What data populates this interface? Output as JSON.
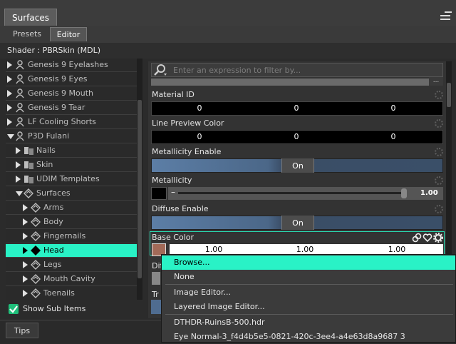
{
  "window": {
    "tab": "Surfaces",
    "menu_icon": "panel-menu-icon"
  },
  "subtabs": {
    "presets": "Presets",
    "editor": "Editor"
  },
  "shader": "Shader :  PBRSkin (MDL)",
  "tree": [
    {
      "label": "Genesis 9 Eyelashes",
      "arrow": "right",
      "icon": "figure-icon",
      "level": 0
    },
    {
      "label": "Genesis 9 Eyes",
      "arrow": "right",
      "icon": "figure-icon",
      "level": 0
    },
    {
      "label": "Genesis 9 Mouth",
      "arrow": "right",
      "icon": "figure-icon",
      "level": 0
    },
    {
      "label": "Genesis 9 Tear",
      "arrow": "right",
      "icon": "figure-icon",
      "level": 0
    },
    {
      "label": "LF Cooling Shorts",
      "arrow": "right",
      "icon": "figure-icon",
      "level": 0
    },
    {
      "label": "P3D Fulani",
      "arrow": "down",
      "icon": "figure-icon",
      "level": 0
    },
    {
      "label": "Nails",
      "arrow": "right",
      "icon": "group-icon",
      "level": 1
    },
    {
      "label": "Skin",
      "arrow": "right",
      "icon": "group-icon",
      "level": 1
    },
    {
      "label": "UDIM Templates",
      "arrow": "right",
      "icon": "group-icon",
      "level": 1
    },
    {
      "label": "Surfaces",
      "arrow": "down",
      "icon": "surfaces-icon",
      "level": 1
    },
    {
      "label": "Arms",
      "arrow": "right",
      "icon": "surface-icon",
      "level": 2
    },
    {
      "label": "Body",
      "arrow": "right",
      "icon": "surface-icon",
      "level": 2
    },
    {
      "label": "Fingernails",
      "arrow": "right",
      "icon": "surface-icon",
      "level": 2
    },
    {
      "label": "Head",
      "arrow": "right",
      "icon": "surface-icon",
      "level": 2,
      "selected": true
    },
    {
      "label": "Legs",
      "arrow": "right",
      "icon": "surface-icon",
      "level": 2
    },
    {
      "label": "Mouth Cavity",
      "arrow": "right",
      "icon": "surface-icon",
      "level": 2
    },
    {
      "label": "Toenails",
      "arrow": "right",
      "icon": "surface-icon",
      "level": 2
    }
  ],
  "show_sub_items": {
    "label": "Show Sub Items",
    "checked": true
  },
  "filter": {
    "placeholder": "Enter an expression to filter by...",
    "more": "..."
  },
  "props": {
    "material_id": {
      "label": "Material ID",
      "values": [
        "0",
        "0",
        "0"
      ]
    },
    "line_preview": {
      "label": "Line Preview Color",
      "values": [
        "0",
        "0",
        "0"
      ]
    },
    "metallicity_enable": {
      "label": "Metallicity Enable",
      "value": "On"
    },
    "metallicity": {
      "label": "Metallicity",
      "minus": "–",
      "value": "1.00",
      "level": 1.0
    },
    "diffuse_enable": {
      "label": "Diffuse Enable",
      "value": "On"
    },
    "base_color": {
      "label": "Base Color",
      "values": [
        "1.00",
        "1.00",
        "1.00"
      ],
      "swatch": "#a26a58"
    },
    "partial_1": {
      "label": "Dif"
    },
    "partial_2": {
      "label": "Tr"
    }
  },
  "context_menu": {
    "items": [
      {
        "label": "Browse...",
        "highlighted": true
      },
      {
        "label": "None"
      },
      {
        "label": "Image Editor..."
      },
      {
        "label": "Layered Image Editor..."
      },
      {
        "label": "DTHDR-RuinsB-500.hdr"
      },
      {
        "label": "Eye Normal-3_f4d4b5e5-0821-420c-3ee4-a4e63d8a9687 3"
      }
    ]
  },
  "bottom": {
    "tips": "Tips"
  },
  "colors": {
    "accent": "#29f2c6",
    "toggle": "#4b6788"
  }
}
